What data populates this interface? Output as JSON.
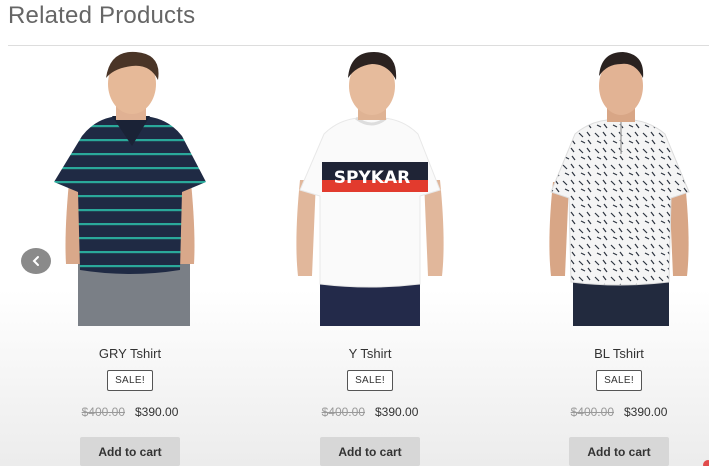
{
  "section": {
    "title": "Related Products"
  },
  "carousel": {
    "prev_icon": "chevron-left-icon"
  },
  "products": [
    {
      "name": "GRY Tshirt",
      "badge": "SALE!",
      "old_price": "$400.00",
      "new_price": "$390.00",
      "cart_label": "Add to cart",
      "shirt": {
        "style": "striped-polo",
        "base": "#1f2a44",
        "stripe": "#2aa89a"
      }
    },
    {
      "name": "Y Tshirt",
      "badge": "SALE!",
      "old_price": "$400.00",
      "new_price": "$390.00",
      "cart_label": "Add to cart",
      "shirt": {
        "style": "graphic-tee",
        "base": "#fafafa",
        "band_top": "#1f2436",
        "band_bottom": "#e23b2e",
        "print_text": "SPYKAR"
      }
    },
    {
      "name": "BL Tshirt",
      "badge": "SALE!",
      "old_price": "$400.00",
      "new_price": "$390.00",
      "cart_label": "Add to cart",
      "shirt": {
        "style": "printed-henley",
        "base": "#f5f5f5",
        "print": "#2d3440"
      }
    }
  ]
}
